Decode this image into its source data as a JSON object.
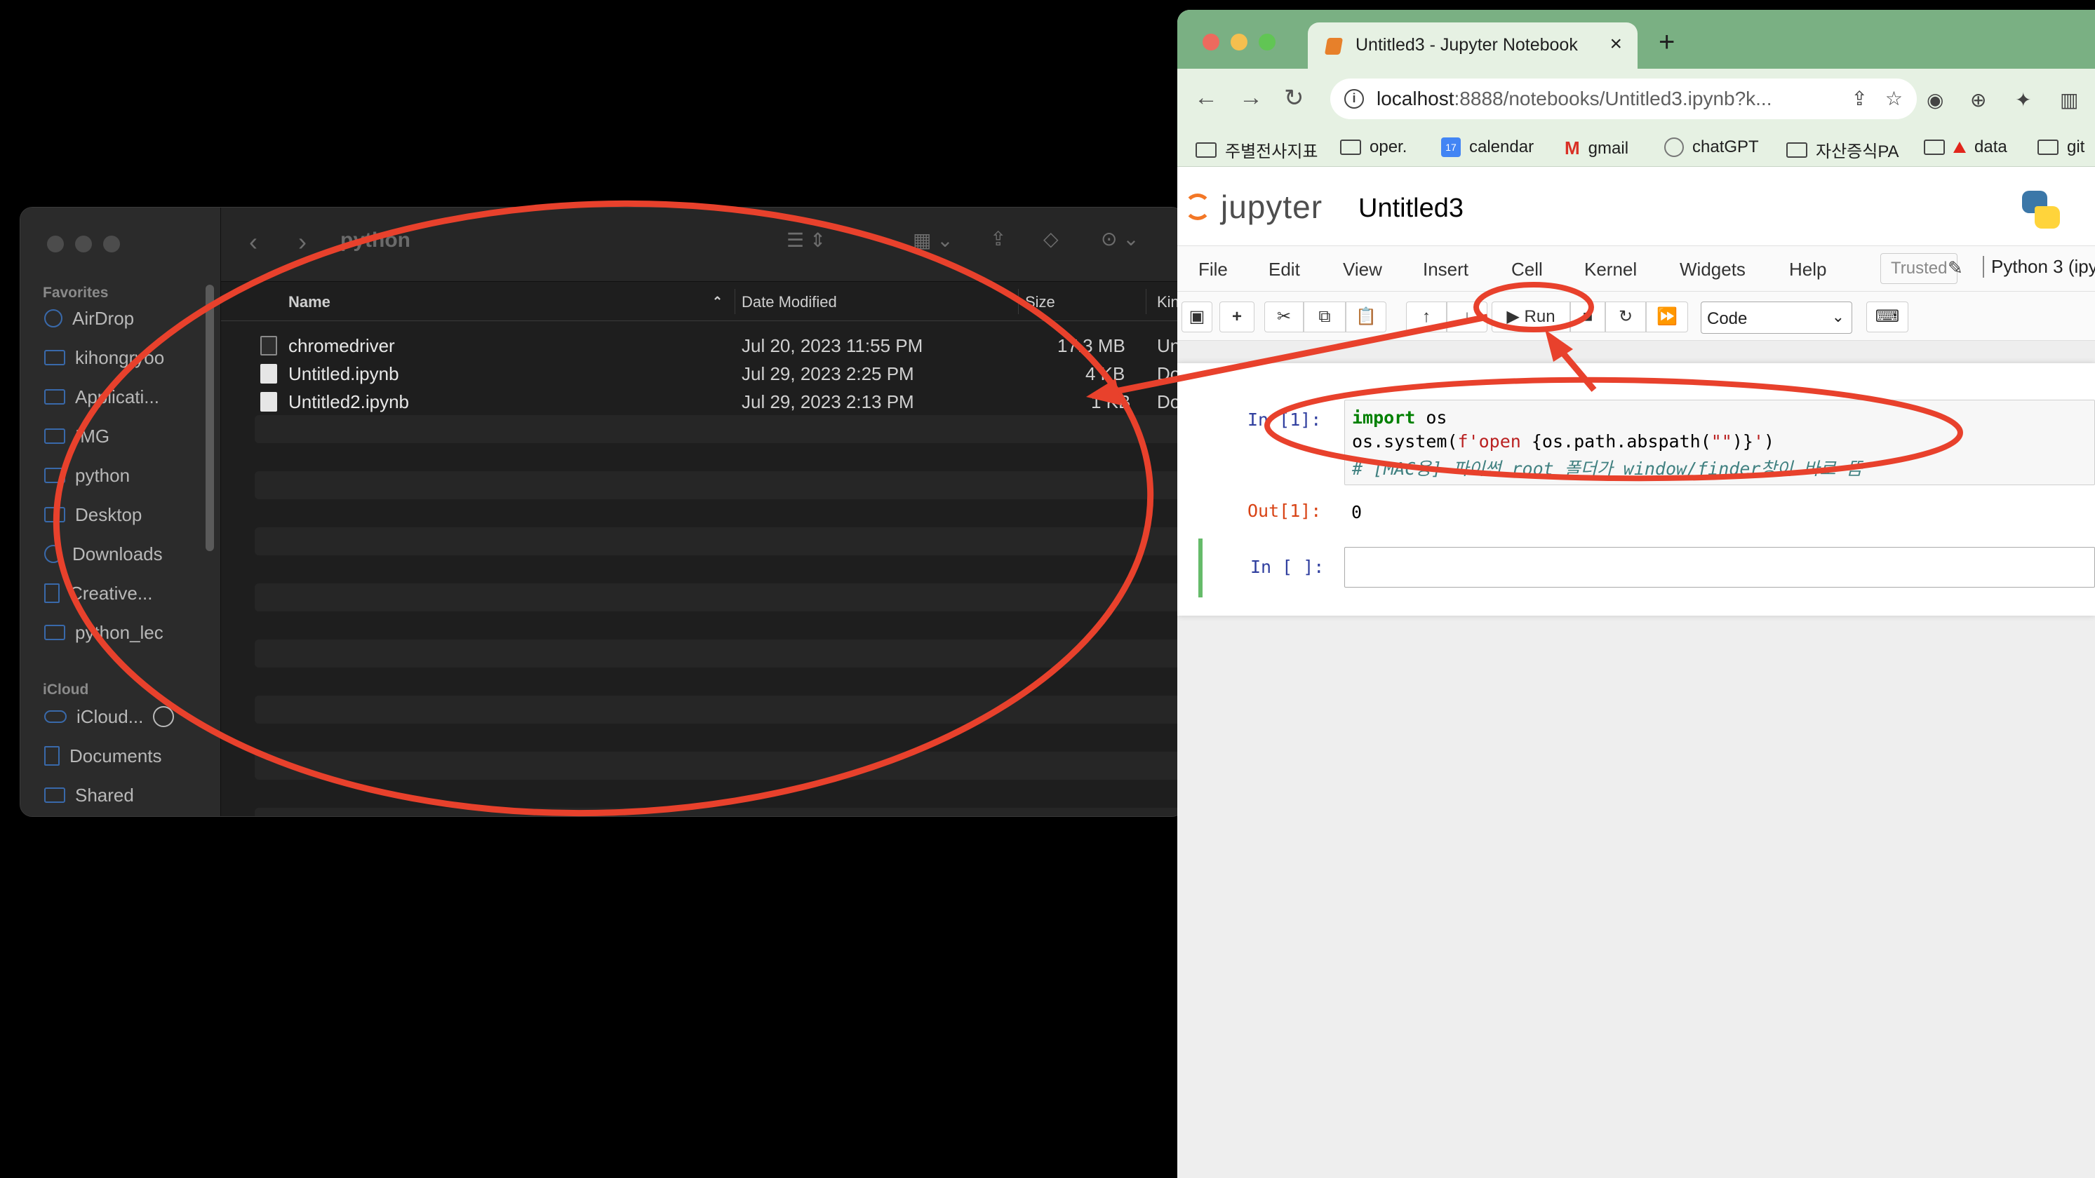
{
  "finder": {
    "title": "python",
    "sidebar": {
      "favorites_label": "Favorites",
      "icloud_label": "iCloud",
      "favorites": [
        "AirDrop",
        "kihongryoo",
        "Applicati...",
        "IMG",
        "python",
        "Desktop",
        "Downloads",
        "Creative...",
        "python_lec"
      ],
      "icloud": [
        "iCloud...",
        "Documents",
        "Shared"
      ]
    },
    "columns": {
      "name": "Name",
      "date": "Date Modified",
      "size": "Size",
      "kind": "Kind"
    },
    "files": [
      {
        "name": "chromedriver",
        "date": "Jul 20, 2023 11:55 PM",
        "size": "17.3 MB",
        "kind": "Unix"
      },
      {
        "name": "Untitled.ipynb",
        "date": "Jul 29, 2023 2:25 PM",
        "size": "4 KB",
        "kind": "Docu"
      },
      {
        "name": "Untitled2.ipynb",
        "date": "Jul 29, 2023 2:13 PM",
        "size": "1 KB",
        "kind": "Docu"
      }
    ]
  },
  "browser": {
    "tab_title": "Untitled3 - Jupyter Notebook",
    "url_host": "localhost",
    "url_rest": ":8888/notebooks/Untitled3.ipynb?k...",
    "bookmarks": [
      "주별전사지표",
      "oper.",
      "calendar",
      "gmail",
      "chatGPT",
      "자산증식PA",
      "data",
      "git"
    ],
    "calendar_icon_text": "17",
    "colors": {
      "tabbar": "#7ab083",
      "toolbar": "#e6f1e3",
      "annotation": "#e8412c"
    }
  },
  "jupyter": {
    "logo_text": "jupyter",
    "notebook_name": "Untitled3",
    "menu": [
      "File",
      "Edit",
      "View",
      "Insert",
      "Cell",
      "Kernel",
      "Widgets",
      "Help"
    ],
    "trusted": "Trusted",
    "kernel": "Python 3 (ipy",
    "run_label": "Run",
    "cell_type": "Code",
    "cell1_prompt": "In [1]:",
    "cell1_code": {
      "l1_kw": "import",
      "l1_rest": " os",
      "l2_a": "os.system(",
      "l2_str": "f'open ",
      "l2_b": "{os.path.abspath(",
      "l2_str2": "\"\"",
      "l2_c": ")}",
      "l2_str3": "'",
      "l2_d": ")",
      "l3_comment": "# [MAC용] 파이썬 root 폴더가 window/finder창이 바로 뜸"
    },
    "out_prompt": "Out[1]:",
    "out_value": "0",
    "cell2_prompt": "In [ ]:"
  }
}
